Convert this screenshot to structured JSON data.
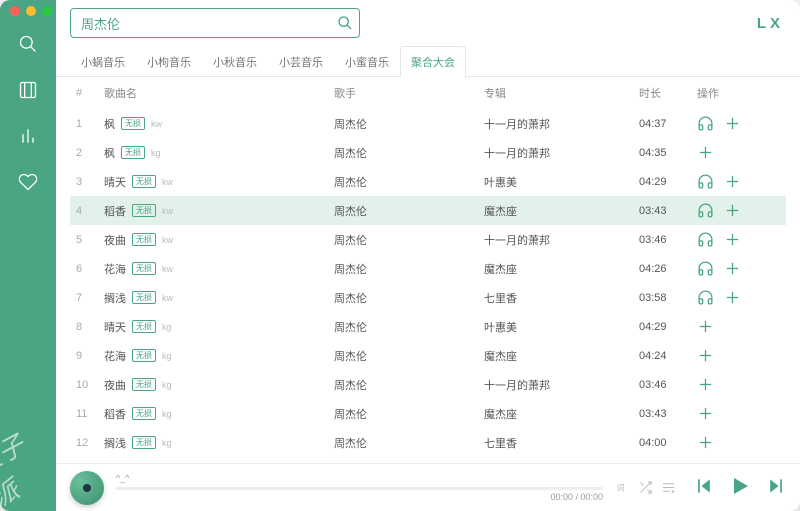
{
  "app": {
    "logo": "LX"
  },
  "search": {
    "value": "周杰伦",
    "placeholder": ""
  },
  "tabs": {
    "items": [
      {
        "label": "小蜗音乐"
      },
      {
        "label": "小枸音乐"
      },
      {
        "label": "小秋音乐"
      },
      {
        "label": "小芸音乐"
      },
      {
        "label": "小蜜音乐"
      },
      {
        "label": "聚合大会"
      }
    ],
    "active": 5
  },
  "columns": {
    "idx": "#",
    "name": "歌曲名",
    "artist": "歌手",
    "album": "专辑",
    "duration": "时长",
    "ops": "操作"
  },
  "songs": [
    {
      "idx": 1,
      "name": "枫",
      "badge": "无损",
      "src": "kw",
      "artist": "周杰伦",
      "album": "十一月的萧邦",
      "duration": "04:37",
      "listenable": true,
      "active": false
    },
    {
      "idx": 2,
      "name": "枫",
      "badge": "无损",
      "src": "kg",
      "artist": "周杰伦",
      "album": "十一月的萧邦",
      "duration": "04:35",
      "listenable": false,
      "active": false
    },
    {
      "idx": 3,
      "name": "晴天",
      "badge": "无损",
      "src": "kw",
      "artist": "周杰伦",
      "album": "叶惠美",
      "duration": "04:29",
      "listenable": true,
      "active": false
    },
    {
      "idx": 4,
      "name": "稻香",
      "badge": "无损",
      "src": "kw",
      "artist": "周杰伦",
      "album": "魔杰座",
      "duration": "03:43",
      "listenable": true,
      "active": true
    },
    {
      "idx": 5,
      "name": "夜曲",
      "badge": "无损",
      "src": "kw",
      "artist": "周杰伦",
      "album": "十一月的萧邦",
      "duration": "03:46",
      "listenable": true,
      "active": false
    },
    {
      "idx": 6,
      "name": "花海",
      "badge": "无损",
      "src": "kw",
      "artist": "周杰伦",
      "album": "魔杰座",
      "duration": "04:26",
      "listenable": true,
      "active": false
    },
    {
      "idx": 7,
      "name": "搁浅",
      "badge": "无损",
      "src": "kw",
      "artist": "周杰伦",
      "album": "七里香",
      "duration": "03:58",
      "listenable": true,
      "active": false
    },
    {
      "idx": 8,
      "name": "晴天",
      "badge": "无损",
      "src": "kg",
      "artist": "周杰伦",
      "album": "叶惠美",
      "duration": "04:29",
      "listenable": false,
      "active": false
    },
    {
      "idx": 9,
      "name": "花海",
      "badge": "无损",
      "src": "kg",
      "artist": "周杰伦",
      "album": "魔杰座",
      "duration": "04:24",
      "listenable": false,
      "active": false
    },
    {
      "idx": 10,
      "name": "夜曲",
      "badge": "无损",
      "src": "kg",
      "artist": "周杰伦",
      "album": "十一月的萧邦",
      "duration": "03:46",
      "listenable": false,
      "active": false
    },
    {
      "idx": 11,
      "name": "稻香",
      "badge": "无损",
      "src": "kg",
      "artist": "周杰伦",
      "album": "魔杰座",
      "duration": "03:43",
      "listenable": false,
      "active": false
    },
    {
      "idx": 12,
      "name": "搁浅",
      "badge": "无损",
      "src": "kg",
      "artist": "周杰伦",
      "album": "七里香",
      "duration": "04:00",
      "listenable": false,
      "active": false
    }
  ],
  "player": {
    "now_playing": "^_^",
    "time": "00:00 / 00:00"
  }
}
